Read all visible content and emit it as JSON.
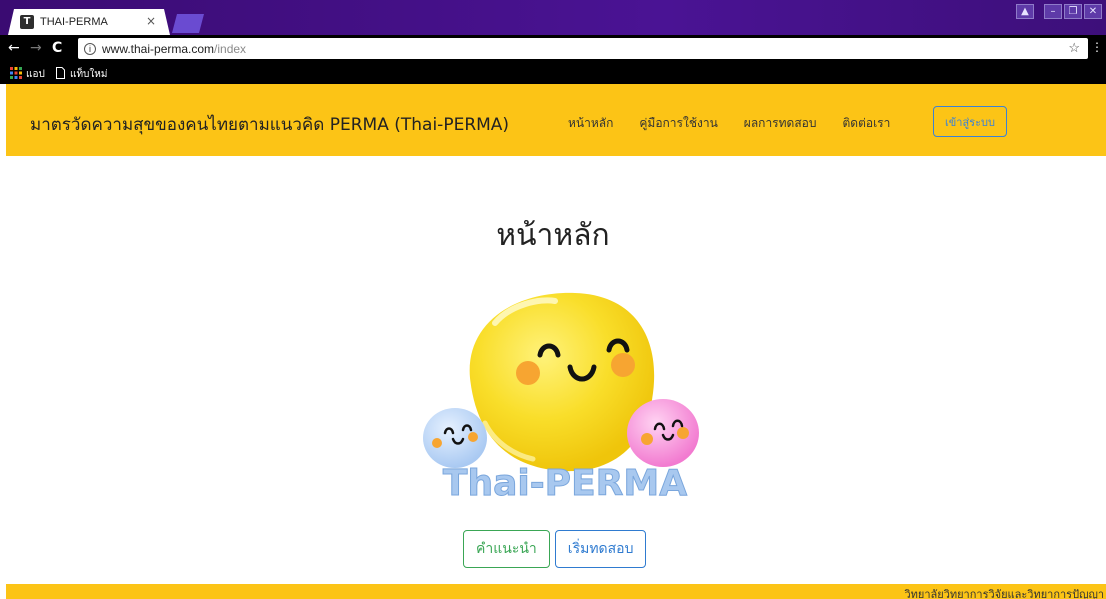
{
  "browser": {
    "tab_title": "THAI-PERMA",
    "tab_favicon": "T",
    "tab_close": "×",
    "url_host": "www.thai-perma.com",
    "url_path": "/index",
    "bookmarks": [
      "แอป",
      "แท็บใหม่"
    ],
    "icons": [
      "back-icon",
      "forward-icon",
      "reload-icon",
      "info-icon",
      "star-icon",
      "menu-icon",
      "apps-icon",
      "page-icon"
    ]
  },
  "navbar": {
    "brand": "มาตรวัดความสุขของคนไทยตามแนวคิด PERMA (Thai-PERMA)",
    "links": [
      "หน้าหลัก",
      "คู่มือการใช้งาน",
      "ผลการทดสอบ",
      "ติดต่อเรา"
    ],
    "login": "เข้าสู่ระบบ"
  },
  "main": {
    "title": "หน้าหลัก",
    "logo_text": "Thai-PERMA",
    "buttons": {
      "advice": "คำแนะนำ",
      "start": "เริ่มทดสอบ"
    }
  },
  "footer": {
    "text": "วิทยาลัยวิทยาการวิจัยและวิทยาการปัญญา"
  },
  "colors": {
    "titlebar": "#4a1394",
    "navbar": "#fcc416",
    "advice_button": "#3aa655",
    "start_button": "#2f7bd0",
    "login_button": "#3b82d6"
  }
}
